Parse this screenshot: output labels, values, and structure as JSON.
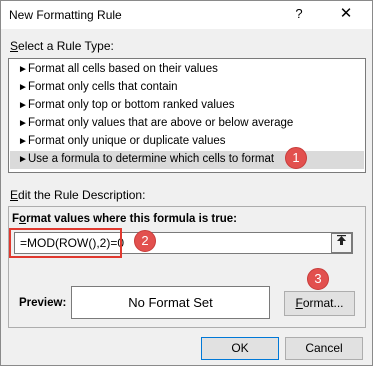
{
  "window": {
    "title": "New Formatting Rule",
    "help": "?",
    "close": "✕"
  },
  "rule_type": {
    "label_u": "S",
    "label_rest": "elect a Rule Type:",
    "items": [
      {
        "label": "Format all cells based on their values",
        "selected": false
      },
      {
        "label": "Format only cells that contain",
        "selected": false
      },
      {
        "label": "Format only top or bottom ranked values",
        "selected": false
      },
      {
        "label": "Format only values that are above or below average",
        "selected": false
      },
      {
        "label": "Format only unique or duplicate values",
        "selected": false
      },
      {
        "label": "Use a formula to determine which cells to format",
        "selected": true
      }
    ]
  },
  "description": {
    "label_u": "E",
    "label_rest": "dit the Rule Description:",
    "formula_label_u": "o",
    "formula_label_pre": "F",
    "formula_label_rest": "rmat values where this formula is true:",
    "formula_value": "=MOD(ROW(),2)=0",
    "preview_label": "Preview:",
    "preview_text": "No Format Set",
    "format_button_u": "F",
    "format_button_rest": "ormat..."
  },
  "buttons": {
    "ok": "OK",
    "cancel": "Cancel"
  },
  "callouts": [
    "1",
    "2",
    "3"
  ],
  "colors": {
    "callout": "#e2504e",
    "highlight_border": "#e0392f",
    "selected_row": "#dadada",
    "default_button_border": "#0078d7"
  },
  "icons": {
    "list_bullet": "arrow-right-icon",
    "collapse": "collapse-dialog-icon"
  }
}
